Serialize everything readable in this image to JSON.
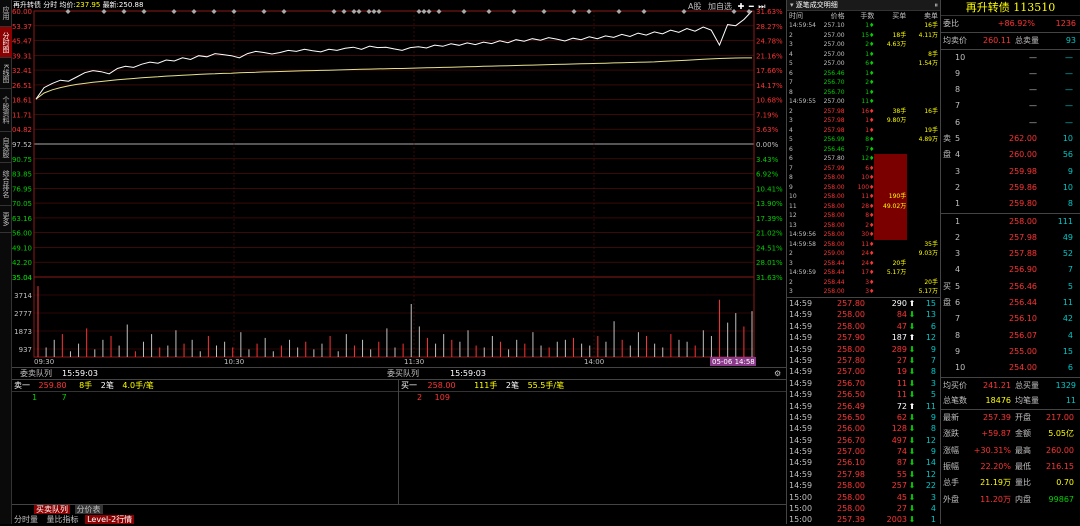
{
  "sidebar": [
    "应用",
    "分时图",
    "K线图",
    "个股资料",
    "自选股",
    "综合排名",
    "更多"
  ],
  "toolbar": {
    "name": "再升转债",
    "mode": "分时",
    "avg_label": "均价:",
    "avg_value": "237.95",
    "last_label": "最新:",
    "last_value": "250.88",
    "right_label": "A股",
    "add_label": "加自选"
  },
  "chart_data": {
    "type": "line",
    "prev_close": 197.52,
    "price_ticks": [
      "260.00",
      "253.37",
      "245.47",
      "239.31",
      "232.41",
      "226.51",
      "218.61",
      "211.71",
      "204.82",
      "197.52",
      "190.75",
      "183.85",
      "176.95",
      "170.05",
      "163.16",
      "156.00",
      "149.10",
      "142.20",
      "135.04"
    ],
    "pct_ticks": [
      "31.63%",
      "28.27%",
      "24.78%",
      "21.16%",
      "17.66%",
      "14.17%",
      "10.68%",
      "7.19%",
      "3.63%",
      "0.00%",
      "3.43%",
      "6.92%",
      "10.41%",
      "13.90%",
      "17.39%",
      "21.02%",
      "24.51%",
      "28.01%",
      "31.63%"
    ],
    "vol_ticks": [
      "3714",
      "2777",
      "1873",
      "937"
    ],
    "time_labels": [
      "09:30",
      "10:30",
      "11:30",
      "14:00"
    ],
    "cursor_label": "05-06 14:58",
    "price": [
      218.6,
      224,
      226,
      227.5,
      227,
      229,
      231,
      232,
      231.5,
      230.5,
      233,
      234,
      233.5,
      235,
      236,
      235.5,
      237,
      236.5,
      238,
      237.2,
      239,
      238.5,
      240,
      239.5,
      239,
      238,
      240,
      241,
      240.5,
      239.8,
      240.5,
      241.5,
      241,
      242,
      241.3,
      240.8,
      242,
      241.5,
      242.5,
      243,
      242,
      243.5,
      242.8,
      243,
      242.2,
      241.5,
      242.8,
      243.2,
      242.6,
      244,
      243.4,
      244.6,
      243.9,
      245,
      244.2,
      245.4,
      244.7,
      246,
      245.1,
      246.5,
      245.8,
      247,
      246.3,
      247.5,
      246.8,
      245.9,
      247.2,
      246.5,
      247.9,
      247,
      248.3,
      247.6,
      249,
      248,
      249.6,
      248.7,
      250.2,
      249.3,
      251,
      250,
      251.8,
      250.5,
      252.5,
      251,
      244,
      253.6,
      253.1,
      256,
      260
    ],
    "avg": [
      218.6,
      221.5,
      223,
      224,
      224.8,
      225.5,
      226,
      226.5,
      226.9,
      227.3,
      227.7,
      228,
      228.3,
      228.6,
      228.9,
      229.1,
      229.4,
      229.6,
      229.8,
      230,
      230.2,
      230.4,
      230.5,
      230.7,
      230.8,
      231,
      231.1,
      231.2,
      231.4,
      231.5,
      231.6,
      231.7,
      231.8,
      231.9,
      232,
      232.1,
      232.2,
      232.3,
      232.4,
      232.5,
      232.6,
      232.7,
      232.8,
      232.9,
      233,
      233,
      233.1,
      233.2,
      233.3,
      233.4,
      233.5,
      233.6,
      233.7,
      233.8,
      233.9,
      234,
      234.1,
      234.2,
      234.3,
      234.4,
      234.5,
      234.6,
      234.7,
      234.8,
      234.9,
      235,
      235.1,
      235.2,
      235.3,
      235.4,
      235.5,
      235.6,
      235.7,
      235.8,
      235.9,
      236,
      236.1,
      236.3,
      236.5,
      236.7,
      236.9,
      237.1,
      237.3,
      237.5,
      237.7,
      237.8,
      237.9,
      237.95,
      237.95
    ],
    "volumes": [
      3714,
      500,
      900,
      1200,
      300,
      700,
      1500,
      400,
      900,
      1100,
      600,
      1700,
      300,
      800,
      1200,
      500,
      600,
      1400,
      700,
      900,
      300,
      1100,
      600,
      800,
      500,
      1300,
      400,
      700,
      1000,
      300,
      600,
      900,
      500,
      800,
      400,
      700,
      1100,
      300,
      1200,
      600,
      900,
      400,
      800,
      1500,
      500,
      700,
      2777,
      1600,
      1000,
      700,
      1200,
      900,
      800,
      1400,
      600,
      500,
      1100,
      800,
      400,
      900,
      700,
      1300,
      600,
      500,
      800,
      900,
      1000,
      700,
      600,
      1100,
      800,
      1873,
      900,
      600,
      1300,
      1100,
      700,
      500,
      1200,
      900,
      800,
      600,
      1400,
      1100,
      3000,
      1800,
      2300,
      1600,
      2400
    ]
  },
  "mid_bar": {
    "left_label": "委卖队列",
    "left_time": "15:59:03",
    "right_label": "委买队列",
    "right_time": "15:59:03"
  },
  "order_queue": {
    "sell": {
      "level": "卖一",
      "price": "259.80",
      "vol": "8手",
      "count": "2笔",
      "avg": "4.0手/笔",
      "q1": "1",
      "q2": "7"
    },
    "buy": {
      "level": "买一",
      "price": "258.00",
      "vol": "111手",
      "count": "2笔",
      "avg": "55.5手/笔",
      "q1": "2",
      "q2": "109"
    }
  },
  "bottom_tabs": {
    "row1": [
      "买卖队列",
      "分价表"
    ],
    "row2": [
      "分时量",
      "量比指标",
      "Level-2行情"
    ]
  },
  "tick_panel": {
    "title": "逐笔成交明细",
    "cols": [
      "时间",
      "价格",
      "手数",
      "买单",
      "卖单"
    ],
    "rows": [
      [
        "14:59:54",
        "257.10",
        "1♦",
        "",
        "16手"
      ],
      [
        "2",
        "257.00",
        "15♦",
        "18手",
        "4.11万"
      ],
      [
        "3",
        "257.00",
        "2♦",
        "4.63万",
        ""
      ],
      [
        "4",
        "257.00",
        "1♦",
        "",
        "8手"
      ],
      [
        "5",
        "257.00",
        "6♦",
        "",
        "1.54万"
      ],
      [
        "6",
        "256.46",
        "1♦",
        "",
        ""
      ],
      [
        "7",
        "256.70",
        "2♦",
        "",
        ""
      ],
      [
        "8",
        "256.70",
        "1♦",
        "",
        ""
      ],
      [
        "14:59:55",
        "257.00",
        "11♦",
        "",
        ""
      ],
      [
        "2",
        "257.98",
        "16♦",
        "38手",
        "16手"
      ],
      [
        "3",
        "257.98",
        "1♦",
        "9.80万",
        ""
      ],
      [
        "4",
        "257.98",
        "1♦",
        "",
        "19手"
      ],
      [
        "5",
        "256.99",
        "8♦",
        "",
        "4.89万"
      ],
      [
        "6",
        "256.46",
        "7♦",
        "",
        ""
      ],
      [
        "6",
        "257.80",
        "12♦",
        "",
        ""
      ],
      [
        "7",
        "257.99",
        "6♦",
        "",
        ""
      ],
      [
        "8",
        "258.00",
        "10♦",
        "",
        ""
      ],
      [
        "9",
        "258.00",
        "100♦",
        "",
        ""
      ],
      [
        "10",
        "258.00",
        "11♦",
        "190手",
        ""
      ],
      [
        "11",
        "258.00",
        "28♦",
        "49.02万",
        ""
      ],
      [
        "12",
        "258.00",
        "8♦",
        "",
        ""
      ],
      [
        "13",
        "258.00",
        "2♦",
        "",
        ""
      ],
      [
        "14:59:56",
        "258.00",
        "30♦",
        "",
        ""
      ],
      [
        "14:59:58",
        "258.00",
        "11♦",
        "",
        "35手"
      ],
      [
        "2",
        "259.00",
        "24♦",
        "",
        "9.03万"
      ],
      [
        "3",
        "258.44",
        "24♦",
        "20手",
        ""
      ],
      [
        "14:59:59",
        "258.44",
        "17♦",
        "5.17万",
        ""
      ],
      [
        "2",
        "258.44",
        "3♦",
        "",
        "20手"
      ],
      [
        "3",
        "258.00",
        "3♦",
        "",
        "5.17万"
      ]
    ]
  },
  "trade_list": [
    [
      "14:59",
      "257.80",
      "290",
      "up",
      "15"
    ],
    [
      "14:59",
      "258.00",
      "84",
      "dn",
      "13"
    ],
    [
      "14:59",
      "258.00",
      "47",
      "dn",
      "6"
    ],
    [
      "14:59",
      "257.90",
      "187",
      "up",
      "12"
    ],
    [
      "14:59",
      "258.00",
      "289",
      "dn",
      "9"
    ],
    [
      "14:59",
      "257.80",
      "27",
      "dn",
      "7"
    ],
    [
      "14:59",
      "257.00",
      "19",
      "dn",
      "8"
    ],
    [
      "14:59",
      "256.70",
      "11",
      "dn",
      "3"
    ],
    [
      "14:59",
      "256.50",
      "11",
      "dn",
      "5"
    ],
    [
      "14:59",
      "256.49",
      "72",
      "up",
      "11"
    ],
    [
      "14:59",
      "256.50",
      "62",
      "dn",
      "9"
    ],
    [
      "14:59",
      "256.00",
      "128",
      "dn",
      "8"
    ],
    [
      "14:59",
      "256.70",
      "497",
      "dn",
      "12"
    ],
    [
      "14:59",
      "257.00",
      "74",
      "dn",
      "9"
    ],
    [
      "14:59",
      "256.10",
      "87",
      "dn",
      "14"
    ],
    [
      "14:59",
      "257.98",
      "55",
      "dn",
      "12"
    ],
    [
      "14:59",
      "258.00",
      "257",
      "dn",
      "22"
    ],
    [
      "15:00",
      "258.00",
      "45",
      "dn",
      "3"
    ],
    [
      "15:00",
      "258.00",
      "27",
      "dn",
      "4"
    ],
    [
      "15:00",
      "257.39",
      "2003",
      "dn",
      "1"
    ]
  ],
  "quote": {
    "title": "再升转债 113510",
    "wb_label": "委比",
    "wb_value": "+86.92%",
    "wb_diff": "1236",
    "ask_avg_label": "均卖价",
    "ask_avg": "260.11",
    "ask_total_label": "总卖量",
    "ask_total": "93",
    "asks": [
      [
        "10",
        "—",
        "—"
      ],
      [
        "9",
        "—",
        "—"
      ],
      [
        "8",
        "—",
        "—"
      ],
      [
        "7",
        "—",
        "—"
      ],
      [
        "6",
        "—",
        "—"
      ],
      [
        "5",
        "262.00",
        "10"
      ],
      [
        "4",
        "260.00",
        "56"
      ],
      [
        "3",
        "259.98",
        "9"
      ],
      [
        "2",
        "259.86",
        "10"
      ],
      [
        "1",
        "259.80",
        "8"
      ]
    ],
    "sell_chars": [
      "卖",
      "盘"
    ],
    "buy_chars": [
      "买",
      "盘"
    ],
    "bids": [
      [
        "1",
        "258.00",
        "111"
      ],
      [
        "2",
        "257.98",
        "49"
      ],
      [
        "3",
        "257.88",
        "52"
      ],
      [
        "4",
        "256.90",
        "7"
      ],
      [
        "5",
        "256.46",
        "5"
      ],
      [
        "6",
        "256.44",
        "11"
      ],
      [
        "7",
        "256.10",
        "42"
      ],
      [
        "8",
        "256.07",
        "4"
      ],
      [
        "9",
        "255.00",
        "15"
      ],
      [
        "10",
        "254.00",
        "6"
      ]
    ],
    "bid_avg_label": "均买价",
    "bid_avg": "241.21",
    "bid_total_label": "总买量",
    "bid_total": "1329",
    "bid_count_label": "总笔数",
    "bid_count": "18476",
    "avg_amt_label": "均笔量",
    "avg_amt": "11",
    "stats": [
      [
        "最新",
        "257.39",
        "开盘",
        "217.00"
      ],
      [
        "涨跌",
        "+59.87",
        "金额",
        "5.05亿"
      ],
      [
        "涨幅",
        "+30.31%",
        "最高",
        "260.00"
      ],
      [
        "振幅",
        "22.20%",
        "最低",
        "216.15"
      ],
      [
        "总手",
        "21.19万",
        "量比",
        "0.70"
      ],
      [
        "外盘",
        "11.20万",
        "内盘",
        "99867"
      ]
    ]
  }
}
